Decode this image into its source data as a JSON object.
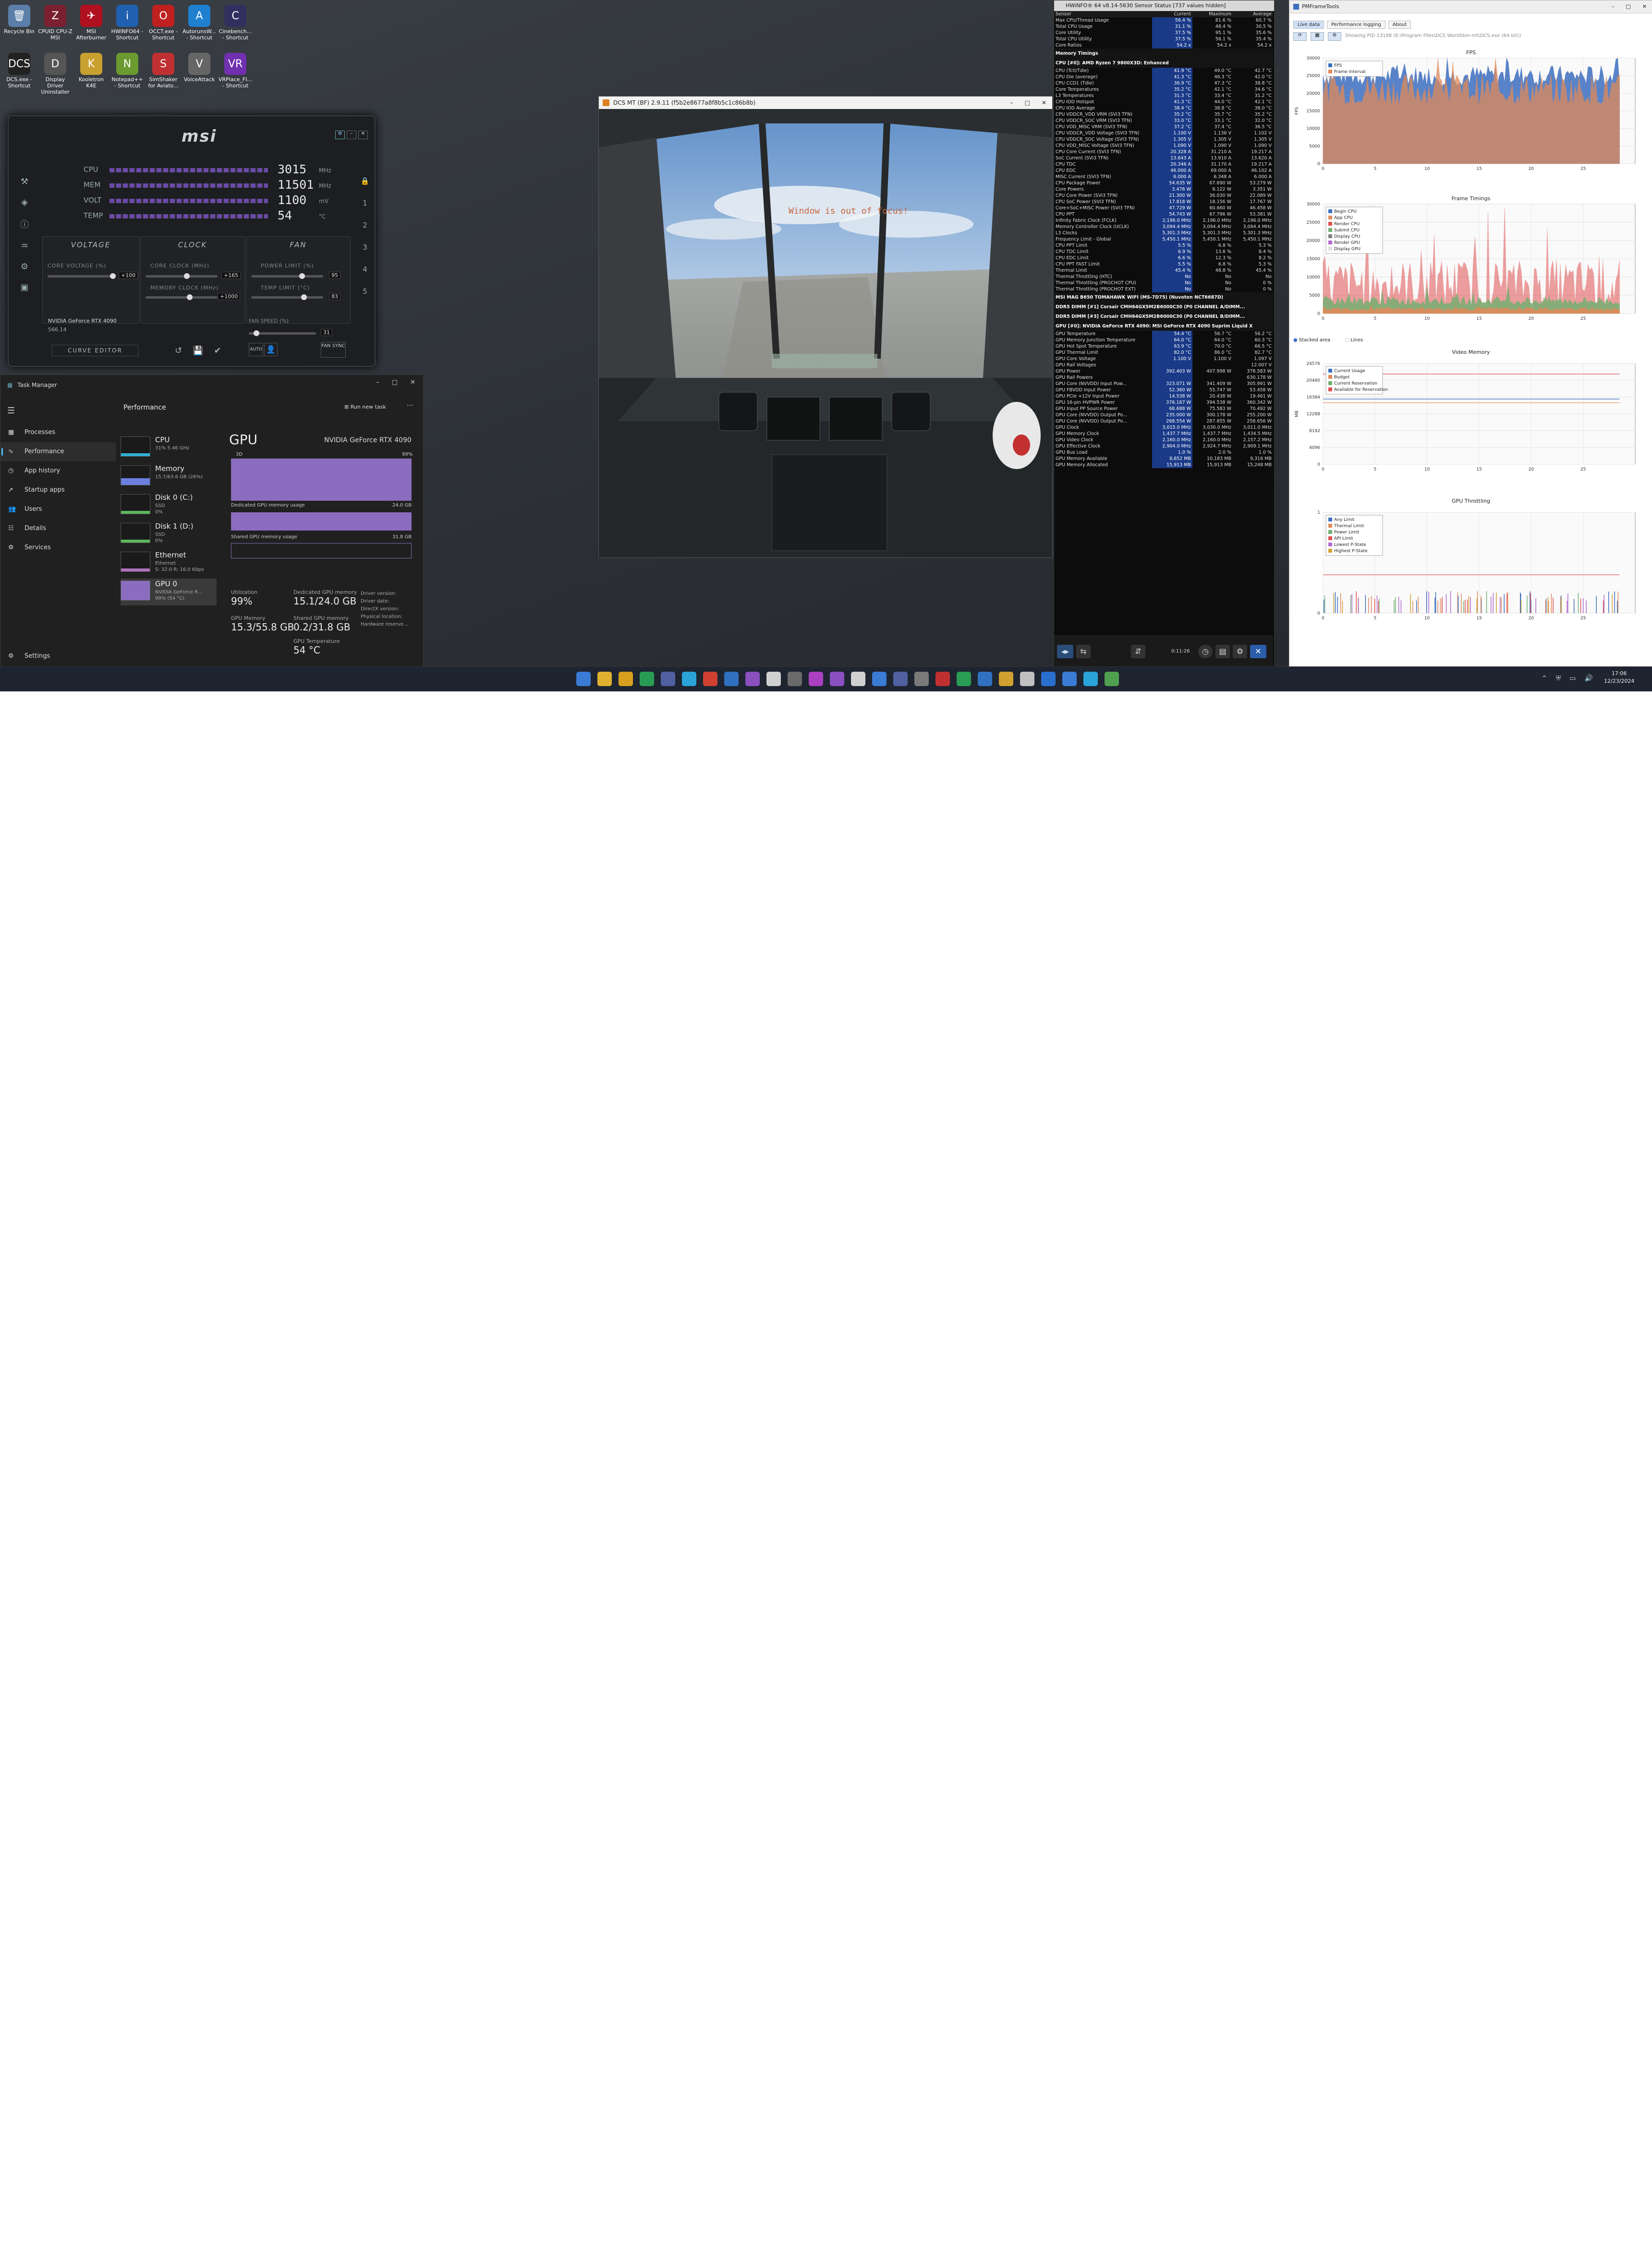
{
  "desktop": {
    "icons": [
      {
        "label": "Recycle Bin",
        "glyph": "🗑",
        "color": "#5b7fa8"
      },
      {
        "label": "CPUID CPU-Z MSI",
        "glyph": "Z",
        "color": "#7a2030"
      },
      {
        "label": "MSI Afterburner",
        "glyph": "✈",
        "color": "#b01020"
      },
      {
        "label": "HWiNFO64 - Shortcut",
        "glyph": "i",
        "color": "#2060b0"
      },
      {
        "label": "OCCT.exe - Shortcut",
        "glyph": "O",
        "color": "#c02020"
      },
      {
        "label": "AutorunsW... - Shortcut",
        "glyph": "A",
        "color": "#2080d0"
      },
      {
        "label": "Cinebench... - Shortcut",
        "glyph": "C",
        "color": "#303060"
      },
      {
        "label": "DCS.exe - Shortcut",
        "glyph": "DCS",
        "color": "#222"
      },
      {
        "label": "Display Driver Uninstaller",
        "glyph": "D",
        "color": "#555"
      },
      {
        "label": "Kooletron K4E",
        "glyph": "K",
        "color": "#c8a030"
      },
      {
        "label": "Notepad++ - Shortcut",
        "glyph": "N",
        "color": "#6a9a30"
      },
      {
        "label": "SimShaker for Aviato...",
        "glyph": "S",
        "color": "#c03030"
      },
      {
        "label": "VoiceAttack",
        "glyph": "V",
        "color": "#666"
      },
      {
        "label": "VRPlace_FI... - Shortcut",
        "glyph": "VR",
        "color": "#7030b0"
      }
    ]
  },
  "msi": {
    "logo": "msi",
    "gpu_name": "NVIDIA GeForce RTX 4090",
    "gpu_driver": "566.14",
    "monitors": [
      {
        "label": "CPU",
        "value": "3015",
        "unit": "MHz"
      },
      {
        "label": "MEM",
        "value": "11501",
        "unit": "MHz"
      },
      {
        "label": "VOLT",
        "value": "1100",
        "unit": "mV"
      },
      {
        "label": "TEMP",
        "value": "54",
        "unit": "°C"
      }
    ],
    "tabs": {
      "voltage": "VOLTAGE",
      "clock": "CLOCK",
      "fan": "FAN"
    },
    "labels": {
      "core_voltage": "CORE VOLTAGE (%)",
      "core_clock": "CORE CLOCK (MHz)",
      "memory_clock": "MEMORY CLOCK (MHz)",
      "power_limit": "POWER LIMIT (%)",
      "temp_limit": "TEMP LIMIT (°C)",
      "fan_speed": "FAN SPEED (%)"
    },
    "values": {
      "core_voltage": "+100",
      "core_clock": "+165",
      "memory_clock": "+1000",
      "power_limit": "95",
      "temp_limit": "83",
      "fan_speed": "31"
    },
    "curve_editor": "CURVE EDITOR",
    "fan_sync": "FAN SYNC",
    "auto": "AUTO"
  },
  "taskmanager": {
    "title": "Task Manager",
    "section": "Performance",
    "run_new_task": "Run new task",
    "more": "···",
    "nav": [
      {
        "label": "Processes",
        "icon": "grid-icon"
      },
      {
        "label": "Performance",
        "icon": "pulse-icon"
      },
      {
        "label": "App history",
        "icon": "history-icon"
      },
      {
        "label": "Startup apps",
        "icon": "rocket-icon"
      },
      {
        "label": "Users",
        "icon": "users-icon"
      },
      {
        "label": "Details",
        "icon": "list-icon"
      },
      {
        "label": "Services",
        "icon": "services-icon"
      }
    ],
    "settings": "Settings",
    "devices": [
      {
        "name": "CPU",
        "sub": "31% 5.46 GHz",
        "color": "#2fb0d8"
      },
      {
        "name": "Memory",
        "sub": "15.7/63.6 GB (26%)",
        "color": "#6a7fe0"
      },
      {
        "name": "Disk 0 (C:)",
        "sub": "SSD\n0%",
        "color": "#5cb85c"
      },
      {
        "name": "Disk 1 (D:)",
        "sub": "SSD\n0%",
        "color": "#5cb85c"
      },
      {
        "name": "Ethernet",
        "sub": "Ethernet\nS: 32.0 R: 16.0 Kbps",
        "color": "#b070c0"
      },
      {
        "name": "GPU 0",
        "sub": "NVIDIA GeForce R...\n99% (54 °C)",
        "color": "#8b6dc0"
      }
    ],
    "gpu": {
      "title": "GPU",
      "model": "NVIDIA GeForce RTX 4090",
      "engine": "3D",
      "engine_pct": "99%",
      "dedicated_label": "Dedicated GPU memory usage",
      "dedicated_max": "24.0 GB",
      "shared_label": "Shared GPU memory usage",
      "shared_max": "31.8 GB",
      "utilization_label": "Utilization",
      "utilization": "99%",
      "ded_mem_label": "Dedicated GPU memory",
      "ded_mem": "15.1/24.0 GB",
      "gpu_mem_label": "GPU Memory",
      "gpu_mem": "15.3/55.8 GB",
      "shared_mem_label": "Shared GPU memory",
      "shared_mem": "0.2/31.8 GB",
      "temp_label": "GPU Temperature",
      "temp": "54 °C",
      "info_labels": [
        "Driver version:",
        "Driver date:",
        "DirectX version:",
        "Physical location:",
        "Hardware reserve..."
      ]
    }
  },
  "dcs": {
    "title": "DCS MT (BF) 2.9.11 (f5b2e8677a8f8b5c1c86b8b)",
    "overlay_text": "Window is out of focus!"
  },
  "hwinfo": {
    "title": "HWiNFO® 64 v8.14-5630 Sensor Status [737 values hidden]",
    "columns": [
      "Sensor",
      "Current",
      "Maximum",
      "Average"
    ],
    "rows": [
      {
        "n": "Max CPU/Thread Usage",
        "c": "56.4 %",
        "m": "81.6 %",
        "a": "60.7 %"
      },
      {
        "n": "Total CPU Usage",
        "c": "31.1 %",
        "m": "48.4 %",
        "a": "30.5 %"
      },
      {
        "n": "Core Utility",
        "c": "37.5 %",
        "m": "95.1 %",
        "a": "35.6 %"
      },
      {
        "n": "Total CPU Utility",
        "c": "37.5 %",
        "m": "56.1 %",
        "a": "35.4 %"
      },
      {
        "n": "Core Ratios",
        "c": "54.2 x",
        "m": "54.2 x",
        "a": "54.2 x"
      },
      {
        "sec": "Memory Timings"
      },
      {
        "sec": "CPU [#0]: AMD Ryzen 7 9800X3D: Enhanced"
      },
      {
        "n": "CPU (Tctl/Tdie)",
        "c": "41.9 °C",
        "m": "49.0 °C",
        "a": "42.7 °C"
      },
      {
        "n": "CPU Die (average)",
        "c": "41.3 °C",
        "m": "46.3 °C",
        "a": "42.0 °C"
      },
      {
        "n": "CPU CCD1 (Tdie)",
        "c": "36.9 °C",
        "m": "47.3 °C",
        "a": "38.8 °C"
      },
      {
        "n": "Core Temperatures",
        "c": "35.2 °C",
        "m": "42.1 °C",
        "a": "34.6 °C"
      },
      {
        "n": "L3 Temperatures",
        "c": "31.3 °C",
        "m": "33.4 °C",
        "a": "31.2 °C"
      },
      {
        "n": "CPU IOD Hotspot",
        "c": "41.3 °C",
        "m": "44.0 °C",
        "a": "42.1 °C"
      },
      {
        "n": "CPU IOD Average",
        "c": "38.4 °C",
        "m": "38.8 °C",
        "a": "38.0 °C"
      },
      {
        "n": "CPU VDDCR_VDD VRM (SVI3 TFN)",
        "c": "35.2 °C",
        "m": "35.7 °C",
        "a": "35.2 °C"
      },
      {
        "n": "CPU VDDCR_SOC VRM (SVI3 TFN)",
        "c": "33.0 °C",
        "m": "33.1 °C",
        "a": "32.0 °C"
      },
      {
        "n": "CPU VDD_MISC VRM (SVI3 TFN)",
        "c": "37.2 °C",
        "m": "37.4 °C",
        "a": "36.5 °C"
      },
      {
        "n": "CPU VDDCR_VDD Voltage (SVI3 TFN)",
        "c": "1.100 V",
        "m": "1.136 V",
        "a": "1.102 V"
      },
      {
        "n": "CPU VDDCR_SOC Voltage (SVI3 TFN)",
        "c": "1.305 V",
        "m": "1.305 V",
        "a": "1.305 V"
      },
      {
        "n": "CPU VDD_MISC Voltage (SVI3 TFN)",
        "c": "1.090 V",
        "m": "1.090 V",
        "a": "1.090 V"
      },
      {
        "n": "CPU Core Current (SVI3 TFN)",
        "c": "20.328 A",
        "m": "31.210 A",
        "a": "19.217 A"
      },
      {
        "n": "SoC Current (SVI3 TFN)",
        "c": "13.643 A",
        "m": "13.910 A",
        "a": "13.620 A"
      },
      {
        "n": "CPU TDC",
        "c": "20.346 A",
        "m": "31.170 A",
        "a": "19.217 A"
      },
      {
        "n": "CPU EDC",
        "c": "46.000 A",
        "m": "69.000 A",
        "a": "46.102 A"
      },
      {
        "n": "MISC Current (SVI3 TFN)",
        "c": "6.000 A",
        "m": "6.348 A",
        "a": "6.000 A"
      },
      {
        "n": "CPU Package Power",
        "c": "54.635 W",
        "m": "67.690 W",
        "a": "53.279 W"
      },
      {
        "n": "Core Powers",
        "c": "3.476 W",
        "m": "8.122 W",
        "a": "3.351 W"
      },
      {
        "n": "CPU Core Power (SVI3 TFN)",
        "c": "21.300 W",
        "m": "36.030 W",
        "a": "22.089 W"
      },
      {
        "n": "CPU SoC Power (SVI3 TFN)",
        "c": "17.818 W",
        "m": "18.156 W",
        "a": "17.767 W"
      },
      {
        "n": "Core+SoC+MISC Power (SVI3 TFN)",
        "c": "47.729 W",
        "m": "60.660 W",
        "a": "46.458 W"
      },
      {
        "n": "CPU PPT",
        "c": "54.743 W",
        "m": "67.796 W",
        "a": "53.381 W"
      },
      {
        "n": "Infinity Fabric Clock (FCLK)",
        "c": "2,196.0 MHz",
        "m": "2,196.0 MHz",
        "a": "2,196.0 MHz"
      },
      {
        "n": "Memory Controller Clock (UCLK)",
        "c": "3,094.4 MHz",
        "m": "3,094.4 MHz",
        "a": "3,094.4 MHz"
      },
      {
        "n": "L3 Clocks",
        "c": "5,301.3 MHz",
        "m": "5,301.3 MHz",
        "a": "5,301.3 MHz"
      },
      {
        "n": "Frequency Limit - Global",
        "c": "5,450.1 MHz",
        "m": "5,450.1 MHz",
        "a": "5,450.1 MHz"
      },
      {
        "n": "CPU PPT Limit",
        "c": "5.5 %",
        "m": "6.8 %",
        "a": "5.3 %"
      },
      {
        "n": "CPU TDC Limit",
        "c": "6.9 %",
        "m": "13.6 %",
        "a": "8.4 %"
      },
      {
        "n": "CPU EDC Limit",
        "c": "6.6 %",
        "m": "12.3 %",
        "a": "8.2 %"
      },
      {
        "n": "CPU PPT FAST Limit",
        "c": "5.5 %",
        "m": "6.8 %",
        "a": "5.3 %"
      },
      {
        "n": "Thermal Limit",
        "c": "45.4 %",
        "m": "48.8 %",
        "a": "45.4 %"
      },
      {
        "n": "Thermal Throttling (HTC)",
        "c": "No",
        "m": "No",
        "a": "No"
      },
      {
        "n": "Thermal Throttling (PROCHOT CPU)",
        "c": "No",
        "m": "No",
        "a": "0 %"
      },
      {
        "n": "Thermal Throttling (PROCHOT EXT)",
        "c": "No",
        "m": "No",
        "a": "0 %"
      },
      {
        "sec": "MSI MAG B650 TOMAHAWK WIFI (MS-7D75) (Nuvoton NCT6687D)"
      },
      {
        "sec": "DDR5 DIMM [#1] Corsair CMH64GX5M2B6000C30 (P0 CHANNEL A/DIMM..."
      },
      {
        "sec": "DDR5 DIMM [#3] Corsair CMH64GX5M2B6000C30 (P0 CHANNEL B/DIMM..."
      },
      {
        "sec": "GPU [#0]: NVIDIA GeForce RTX 4090: MSI GeForce RTX 4090 Suprim Liquid X"
      },
      {
        "n": "GPU Temperature",
        "c": "54.4 °C",
        "m": "56.7 °C",
        "a": "56.2 °C"
      },
      {
        "n": "GPU Memory Junction Temperature",
        "c": "64.0 °C",
        "m": "64.0 °C",
        "a": "60.3 °C"
      },
      {
        "n": "GPU Hot Spot Temperature",
        "c": "63.9 °C",
        "m": "70.0 °C",
        "a": "66.5 °C"
      },
      {
        "n": "GPU Thermal Limit",
        "c": "82.0 °C",
        "m": "86.0 °C",
        "a": "82.7 °C"
      },
      {
        "n": "GPU Core Voltage",
        "c": "1.100 V",
        "m": "1.100 V",
        "a": "1.097 V"
      },
      {
        "n": "GPU Rail Voltages",
        "c": "",
        "m": "",
        "a": "12.007 V"
      },
      {
        "n": "GPU Power",
        "c": "392.403 W",
        "m": "407.998 W",
        "a": "378.583 W"
      },
      {
        "n": "GPU Rail Powers",
        "c": "",
        "m": "",
        "a": "630.178 W"
      },
      {
        "n": "GPU Core (NVVDD) Input Pow...",
        "c": "323.071 W",
        "m": "341.409 W",
        "a": "305.991 W"
      },
      {
        "n": "GPU FBVDD Input Power",
        "c": "52.360 W",
        "m": "55.747 W",
        "a": "53.458 W"
      },
      {
        "n": "GPU PCIe +12V Input Power",
        "c": "14.538 W",
        "m": "20.438 W",
        "a": "19.461 W"
      },
      {
        "n": "GPU 16-pin HVPWR Power",
        "c": "376.167 W",
        "m": "394.538 W",
        "a": "360.342 W"
      },
      {
        "n": "GPU Input PP Source Power",
        "c": "68.688 W",
        "m": "75.583 W",
        "a": "70.492 W"
      },
      {
        "n": "GPU Core (NVVDD) Output Po...",
        "c": "235.000 W",
        "m": "300.178 W",
        "a": "255.200 W"
      },
      {
        "n": "GPU Core (NVVDD) Output Po...",
        "c": "268.554 W",
        "m": "287.855 W",
        "a": "258.656 W"
      },
      {
        "n": "GPU Clock",
        "c": "3,015.0 MHz",
        "m": "3,030.0 MHz",
        "a": "3,011.0 MHz"
      },
      {
        "n": "GPU Memory Clock",
        "c": "1,437.7 MHz",
        "m": "1,437.7 MHz",
        "a": "1,434.5 MHz"
      },
      {
        "n": "GPU Video Clock",
        "c": "2,160.0 MHz",
        "m": "2,160.0 MHz",
        "a": "2,157.2 MHz"
      },
      {
        "n": "GPU Effective Clock",
        "c": "2,904.0 MHz",
        "m": "2,924.7 MHz",
        "a": "2,909.1 MHz"
      },
      {
        "n": "GPU Bus Load",
        "c": "1.0 %",
        "m": "2.0 %",
        "a": "1.0 %"
      },
      {
        "n": "GPU Memory Available",
        "c": "8,652 MB",
        "m": "10,183 MB",
        "a": "9,316 MB"
      },
      {
        "n": "GPU Memory Allocated",
        "c": "15,913 MB",
        "m": "15,913 MB",
        "a": "15,248 MB"
      }
    ],
    "clock": "0:11:26"
  },
  "presentmon": {
    "title": "PMFrameTools",
    "tabs": [
      "Live data",
      "Performance logging",
      "About"
    ],
    "status": "Showing PID 13188 (E:\\Program Files\\DCS World\\bin-mt\\DCS.exe (64 bit))",
    "stacked_label": "Stacked area",
    "lines_label": "Lines"
  },
  "chart_data": [
    {
      "type": "area",
      "title": "FPS",
      "x": [
        0,
        5,
        10,
        15,
        20,
        25
      ],
      "yticks": [
        0,
        5000,
        10000,
        15000,
        20000,
        25000,
        30000
      ],
      "ylim": [
        0,
        30000
      ],
      "xlim": [
        0,
        30
      ],
      "ylabel": "FPS",
      "legend": [
        "FPS",
        "Frame Interval"
      ],
      "legend_colors": [
        "#3e6fc0",
        "#e08a5a"
      ],
      "legend_position": "top-left"
    },
    {
      "type": "area",
      "title": "Frame Timings",
      "x": [
        0,
        5,
        10,
        15,
        20,
        25
      ],
      "yticks": [
        0,
        5000,
        10000,
        15000,
        20000,
        25000,
        30000
      ],
      "ylim": [
        0,
        30000
      ],
      "xlim": [
        0,
        30
      ],
      "legend": [
        "Begin CPU",
        "App CPU",
        "Render CPU",
        "Submit CPU",
        "Display CPU",
        "Render GPU",
        "Display GPU"
      ],
      "legend_colors": [
        "#3e6fc0",
        "#e08a5a",
        "#e05050",
        "#70b070",
        "#808080",
        "#b06ad0",
        "#e0e0e0"
      ],
      "legend_position": "top-left"
    },
    {
      "type": "line",
      "title": "Video Memory",
      "x": [
        0,
        5,
        10,
        15,
        20,
        25
      ],
      "yticks": [
        0,
        4096,
        8192,
        12288,
        16384,
        20480,
        24576
      ],
      "ylim": [
        0,
        24576
      ],
      "xlim": [
        0,
        30
      ],
      "ylabel": "MB",
      "legend": [
        "Current Usage",
        "Budget",
        "Current Reservation",
        "Available for Reservation"
      ],
      "legend_colors": [
        "#3e6fc0",
        "#e08a5a",
        "#70b070",
        "#e05050"
      ],
      "legend_position": "top-left"
    },
    {
      "type": "line",
      "title": "GPU Throttling",
      "x": [
        0,
        5,
        10,
        15,
        20,
        25
      ],
      "yticks": [
        0,
        1
      ],
      "ylim": [
        0,
        1
      ],
      "xlim": [
        0,
        30
      ],
      "legend": [
        "Any Limit",
        "Thermal Limit",
        "Power Limit",
        "API Limit",
        "Lowest P-State",
        "Highest P-State"
      ],
      "legend_colors": [
        "#3e6fc0",
        "#e08a5a",
        "#70b070",
        "#e05050",
        "#b06ad0",
        "#d0a030"
      ],
      "legend_position": "top-left"
    }
  ],
  "taskbar": {
    "time": "17:06",
    "date": "12/23/2024"
  }
}
